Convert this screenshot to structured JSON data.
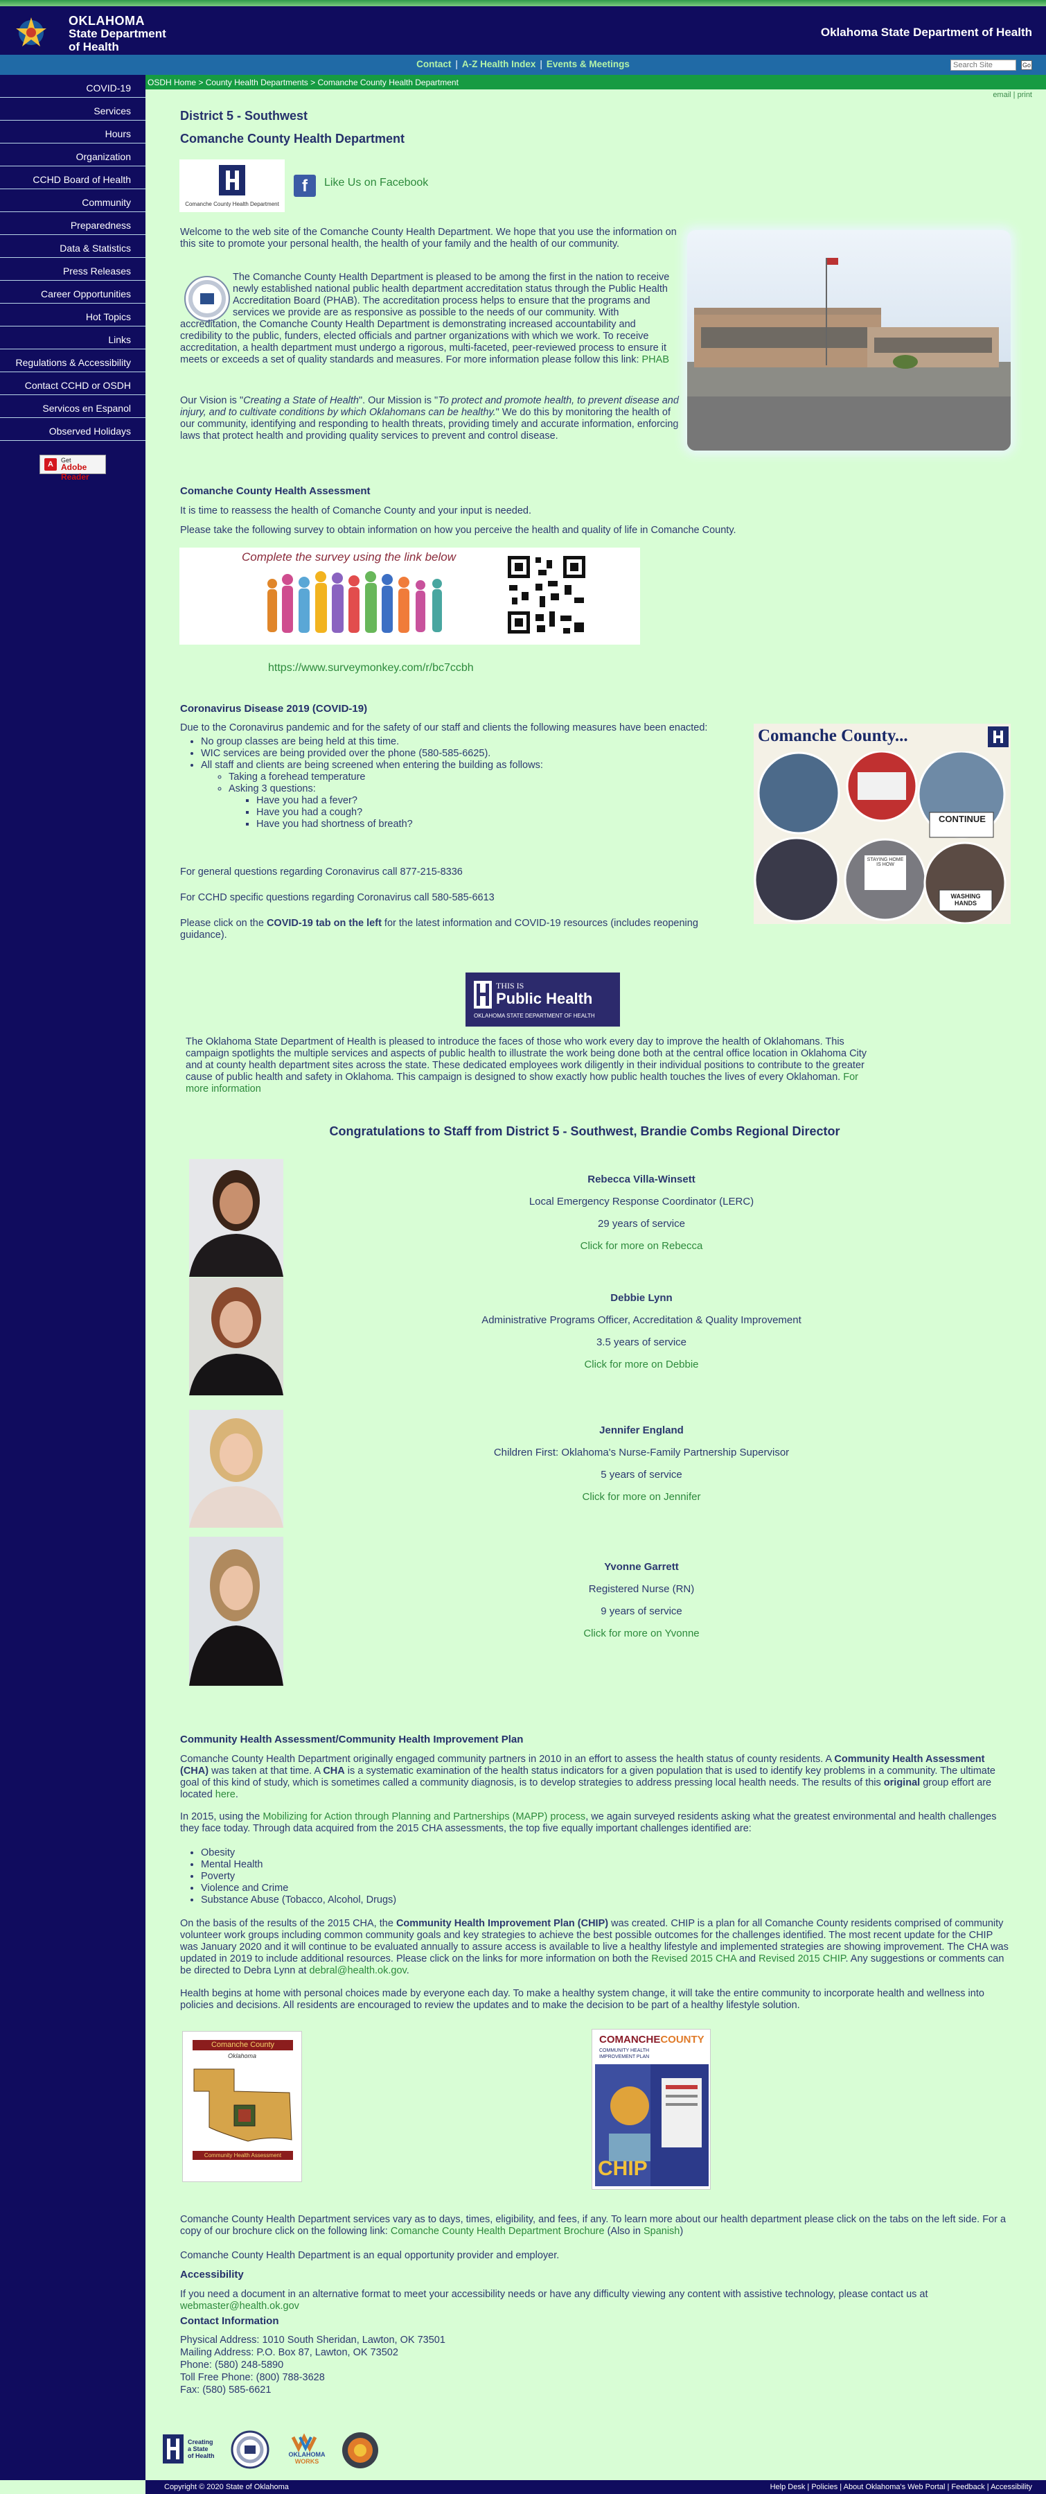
{
  "header": {
    "logo_line1": "OKLAHOMA",
    "logo_line2": "State Department",
    "logo_line3": "of Health",
    "site_name": "Oklahoma State Department of Health"
  },
  "topnav": {
    "links": [
      "Contact",
      "A-Z Health Index",
      "Events & Meetings"
    ],
    "separator": "|"
  },
  "search": {
    "placeholder": "Search Site",
    "go_label": "Go"
  },
  "sidebar": {
    "items": [
      "COVID-19",
      "Services",
      "Hours",
      "Organization",
      "CCHD Board of Health",
      "Community",
      "Preparedness",
      "Data & Statistics",
      "Press Releases",
      "Career Opportunities",
      "Hot Topics",
      "Links",
      "Regulations & Accessibility",
      "Contact CCHD or OSDH",
      "Servicos en Espanol",
      "Observed Holidays"
    ],
    "adobe_get": "Get",
    "adobe_label": "Adobe Reader"
  },
  "breadcrumb": {
    "items": [
      "OSDH Home",
      "County Health Departments",
      "Comanche County Health Department"
    ],
    "separator": ">"
  },
  "util": {
    "email": "email",
    "print": "print",
    "separator": "|"
  },
  "page": {
    "district": "District 5 - Southwest",
    "title": "Comanche County Health Department",
    "logo_caption": "Comanche County Health Department",
    "facebook_label": "Like Us on Facebook",
    "welcome": "Welcome to the web site of the Comanche County Health Department. We hope that you use the information on this site to promote your personal health, the health of your family and the health of our community.",
    "phab_text": "The Comanche County Health Department is pleased to be among the first in the nation to receive newly established national public health department accreditation status through the Public Health Accreditation Board (PHAB). The accreditation process helps to ensure that the programs and services we provide are as responsive as possible to the needs of our community.  With accreditation, the Comanche County Health Department is demonstrating increased accountability and credibility to the public, funders, elected officials and partner organizations with which we work.  To receive accreditation, a health department must undergo a rigorous, multi-faceted, peer-reviewed process to ensure it meets or exceeds a set of quality standards and measures.  For more information please follow this link:",
    "phab_link": "PHAB",
    "vision_prefix": "Our Vision is \"",
    "vision": "Creating a State of Health",
    "mission_prefix": "\".  Our Mission is \"",
    "mission": "To protect and promote health, to prevent disease and injury, and to cultivate conditions by which Oklahomans can be healthy.",
    "vision_suffix": "\"  We do this by monitoring the health of our community, identifying and responding to health threats, providing timely and accurate information, enforcing laws that protect health and providing quality services to prevent and control disease."
  },
  "assessment": {
    "heading": "Comanche County Health Assessment",
    "p1": "It is time to reassess the health of Comanche County and your input is needed.",
    "p2": "Please take the following survey to obtain information on how you perceive the health and quality of life in Comanche County.",
    "banner_text": "Complete the survey using the link below",
    "survey_link": "https://www.surveymonkey.com/r/bc7ccbh"
  },
  "covid": {
    "heading": "Coronavirus Disease 2019 (COVID-19)",
    "intro": "Due to the Coronavirus pandemic and for the safety of our staff and clients the following measures have been enacted:",
    "b1": "No group classes are being held at this time.",
    "b2": "WIC services are being provided over the phone (580-585-6625).",
    "b3": "All staff and clients are being screened when entering the building as follows:",
    "s1": "Taking a forehead temperature",
    "s2": "Asking 3 questions:",
    "q1": "Have you had a fever?",
    "q2": "Have you had a cough?",
    "q3": "Have you had shortness of breath?",
    "general": "For general questions regarding Coronavirus call 877-215-8336",
    "cchd": "For CCHD specific questions regarding Coronavirus call 580-585-6613",
    "click_prefix": "Please click on the ",
    "click_bold": "COVID-19 tab on the left",
    "click_suffix": " for the latest information and COVID-19 resources (includes reopening guidance).",
    "collage_title": "Comanche County...",
    "sign1": "CONTINUE",
    "sign2": "WASHING HANDS",
    "sign3": "STAYING HOME IS HOW"
  },
  "tiph": {
    "badge_small": "THIS IS",
    "badge_big": "Public Health",
    "badge_sub": "OKLAHOMA STATE DEPARTMENT OF HEALTH",
    "text": "The Oklahoma State Department of Health is pleased to introduce the faces of those who work every day to improve the health of Oklahomans.  This campaign spotlights the multiple services and aspects of public health to illustrate the work being done both at the central office location in Oklahoma City  and at county health department sites across the state. These dedicated employees work diligently in their individual positions to contribute to the greater cause of public health and safety in Oklahoma. This campaign is designed to show exactly how public health touches the lives of every Oklahoman.",
    "more": "For more information"
  },
  "congrats": "Congratulations to Staff from District 5 - Southwest, Brandie Combs Regional Director",
  "staff": [
    {
      "name": "Rebecca Villa-Winsett",
      "role": "Local Emergency Response Coordinator (LERC)",
      "years": "29 years of service",
      "link": "Click for more on Rebecca"
    },
    {
      "name": "Debbie Lynn",
      "role": "Administrative Programs Officer, Accreditation & Quality Improvement",
      "years": "3.5 years of service",
      "link": "Click for more on Debbie"
    },
    {
      "name": "Jennifer England",
      "role": "Children First: Oklahoma's Nurse-Family Partnership Supervisor",
      "years": "5 years of service",
      "link": "Click for more on Jennifer"
    },
    {
      "name": "Yvonne Garrett",
      "role": "Registered Nurse (RN)",
      "years": "9 years of service",
      "link": "Click for more on Yvonne"
    }
  ],
  "cha": {
    "heading": "Community Health Assessment/Community Health Improvement Plan",
    "p1a": "Comanche County Health Department originally engaged community partners in 2010 in an effort to assess the health status of county residents. A ",
    "p1b": "Community Health Assessment (CHA)",
    "p1c": " was taken at that time.  A ",
    "p1d": "CHA",
    "p1e": " is a systematic examination of the health status indicators for a given population that is used to identify key problems in a community. The ultimate goal of this kind of study, which is sometimes called a community diagnosis, is to develop strategies to address pressing local health needs. The results of this ",
    "p1f": "original",
    "p1g": " group effort are located ",
    "p1h": "here",
    "p1i": ".",
    "p2a": "In 2015, using the ",
    "p2b": "Mobilizing for Action through Planning and Partnerships (MAPP) process",
    "p2c": ", we again surveyed residents asking what the greatest environmental and health challenges they face today.  Through data acquired from the 2015 CHA assessments, the top five equally important challenges identified are:",
    "list": [
      "Obesity",
      "Mental Health",
      "Poverty",
      "Violence and Crime",
      "Substance Abuse (Tobacco, Alcohol, Drugs)"
    ],
    "p3a": "On the basis of the results of the 2015 CHA, the ",
    "p3b": "Community Health Improvement Plan (CHIP)",
    "p3c": " was created.  CHIP is a plan for all Comanche County residents comprised of community volunteer work groups including common community goals and key strategies to achieve the best possible outcomes for the challenges identified.  The most recent update for the CHIP was January 2020 and it will continue to be evaluated annually to assure access is available to live a healthy lifestyle and implemented strategies are showing improvement.  The CHA was updated in 2019 to include additional resources.  Please click on the links for more information on both the ",
    "p3d": "Revised 2015 CHA",
    "p3e": " and ",
    "p3f": "Revised 2015 CHIP",
    "p3g": ".  Any suggestions or comments can be directed to Debra Lynn at ",
    "p3h": "debral@health.ok.gov",
    "p3i": ".",
    "p4": "Health begins at home with personal choices made by everyone each day. To make a healthy system change, it will take the entire community to incorporate health and wellness into policies and decisions.  All residents are encouraged to review the updates and to make the decision to be part of a healthy lifestyle solution.",
    "cover1_top": "Comanche County",
    "cover1_sub": "Oklahoma",
    "cover1_bottom": "Community Health Assessment",
    "cover2_top1": "COMANCHE",
    "cover2_top2": "COUNTY",
    "cover2_sub": "COMMUNITY HEALTH IMPROVEMENT PLAN",
    "cover2_big": "CHIP"
  },
  "closing": {
    "p1a": "Comanche County Health Department services vary as to days, times, eligibility, and fees, if any.  To learn more about our health department please click on the tabs on the left side.  For a copy of our brochure click on the following link:  ",
    "p1b": "Comanche County Health Department Brochure",
    "p1c": " (Also in ",
    "p1d": "Spanish",
    "p1e": ")",
    "p2": "Comanche County Health Department is an equal opportunity provider and employer.",
    "acc_heading": "Accessibility",
    "acc_text": "If you need a document in an alternative format to meet your accessibility needs or have any difficulty viewing any content with assistive technology, please contact us at",
    "acc_email": "webmaster@health.ok.gov",
    "contact_heading": "Contact Information",
    "contact": [
      "Physical Address: 1010 South Sheridan, Lawton, OK 73501",
      "Mailing Address: P.O. Box 87, Lawton, OK 73502",
      "Phone: (580) 248-5890",
      "Toll Free Phone: (800) 788-3628",
      "Fax: (580) 585-6621"
    ]
  },
  "footer_logos": {
    "csh1": "Creating",
    "csh2": "a State",
    "csh3": "of Health",
    "okw1": "OKLAHOMA",
    "okw2": "WORKS"
  },
  "footer": {
    "copyright": "Copyright © 2020 State of Oklahoma",
    "links": [
      "Help Desk",
      "Policies",
      "About Oklahoma's Web Portal",
      "Feedback",
      "Accessibility"
    ],
    "separator": "|"
  },
  "colors": {
    "navy": "#100c5e",
    "green_bar": "#169b42",
    "blue_bar": "#206aa6",
    "page_bg": "#d8fdd5",
    "link": "#2d8a3c",
    "text": "#2c3870"
  }
}
